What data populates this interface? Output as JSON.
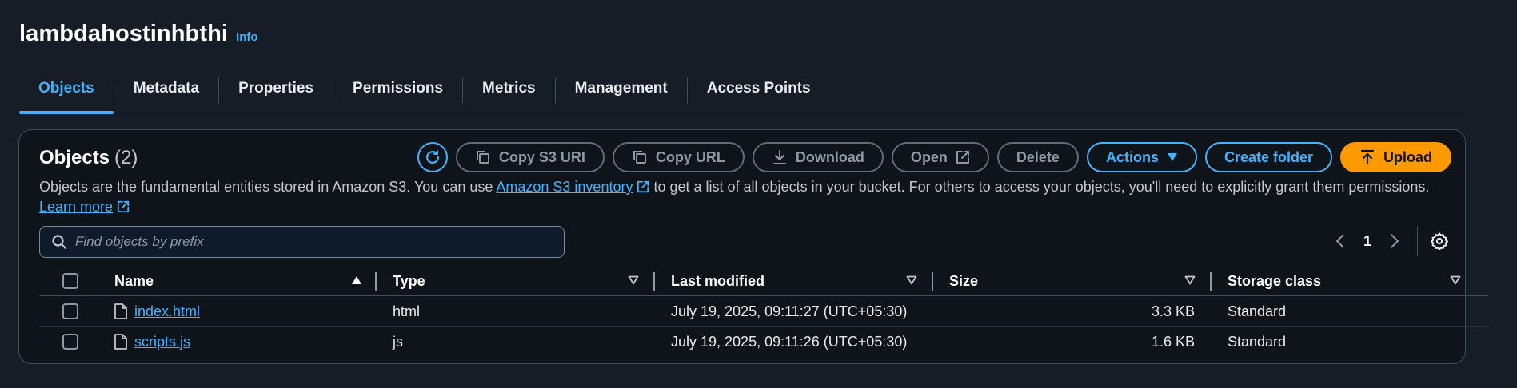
{
  "bucket": {
    "name": "lambdahostinhbthi",
    "info_label": "Info"
  },
  "tabs": [
    {
      "label": "Objects",
      "active": true
    },
    {
      "label": "Metadata"
    },
    {
      "label": "Properties"
    },
    {
      "label": "Permissions"
    },
    {
      "label": "Metrics"
    },
    {
      "label": "Management"
    },
    {
      "label": "Access Points"
    }
  ],
  "objects_panel": {
    "title": "Objects",
    "count": "(2)",
    "description_before": "Objects are the fundamental entities stored in Amazon S3. You can use ",
    "inventory_link": "Amazon S3 inventory",
    "description_after": " to get a list of all objects in your bucket. For others to access your objects, you'll need to explicitly grant them permissions. ",
    "learn_more_link": "Learn more"
  },
  "toolbar": {
    "refresh_icon": "refresh-icon",
    "copy_s3_uri": "Copy S3 URI",
    "copy_url": "Copy URL",
    "download": "Download",
    "open": "Open",
    "delete": "Delete",
    "actions": "Actions",
    "create_folder": "Create folder",
    "upload": "Upload"
  },
  "search": {
    "placeholder": "Find objects by prefix"
  },
  "pagination": {
    "current_page": "1"
  },
  "table": {
    "columns": [
      "Name",
      "Type",
      "Last modified",
      "Size",
      "Storage class"
    ],
    "rows": [
      {
        "name": "index.html",
        "type": "html",
        "last_modified": "July 19, 2025, 09:11:27 (UTC+05:30)",
        "size": "3.3 KB",
        "storage_class": "Standard"
      },
      {
        "name": "scripts.js",
        "type": "js",
        "last_modified": "July 19, 2025, 09:11:26 (UTC+05:30)",
        "size": "1.6 KB",
        "storage_class": "Standard"
      }
    ]
  },
  "colors": {
    "accent": "#42b4ff",
    "upload": "#ff9900",
    "background": "#161d26",
    "panel": "#0f141a"
  }
}
